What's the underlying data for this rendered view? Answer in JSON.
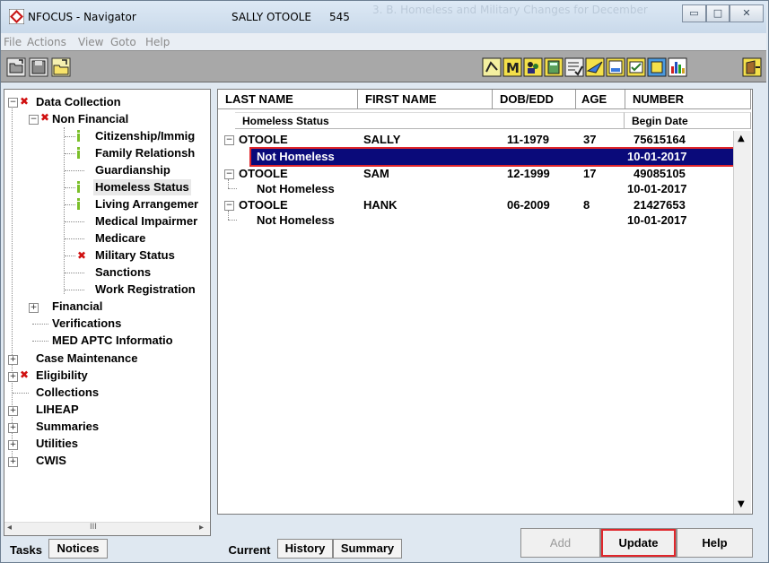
{
  "window": {
    "app_title": "NFOCUS - Navigator",
    "user": "SALLY OTOOLE",
    "user_number": "545",
    "faded_title": "3. B. Homeless and Military Changes for December",
    "minimize": "▭",
    "maximize": "□",
    "close": "✕"
  },
  "menu": [
    "File",
    "Actions",
    "View",
    "Goto",
    "Help"
  ],
  "toolbar_icons": [
    "folder-icon",
    "save-icon",
    "new-folder-icon",
    "gauge-icon",
    "map-icon",
    "people-icon",
    "calculator-icon",
    "checklist-icon",
    "plane-icon",
    "form-icon",
    "check-form-icon",
    "window-icon",
    "bar-chart-icon",
    "exit-icon"
  ],
  "tree": {
    "data_collection": "Data Collection",
    "non_financial": "Non Financial",
    "items": [
      "Citizenship/Immig",
      "Family Relationsh",
      "Guardianship",
      "Homeless Status",
      "Living Arrangemer",
      "Medical Impairmer",
      "Medicare",
      "Military Status",
      "Sanctions",
      "Work Registration"
    ],
    "financial": "Financial",
    "verifications": "Verifications",
    "med_aptc": "MED APTC Informatio",
    "case_maintenance": "Case Maintenance",
    "eligibility": "Eligibility",
    "collections": "Collections",
    "liheap": "LIHEAP",
    "summaries": "Summaries",
    "utilities": "Utilities",
    "cwis": "CWIS"
  },
  "left_tabs": [
    "Tasks",
    "Notices"
  ],
  "grid": {
    "headers": [
      "LAST NAME",
      "FIRST NAME",
      "DOB/EDD",
      "AGE",
      "NUMBER"
    ],
    "subheaders": [
      "Homeless Status",
      "Begin Date"
    ],
    "people": [
      {
        "last": "OTOOLE",
        "first": "SALLY",
        "dob": "11-1979",
        "age": "37",
        "number": "75615164",
        "status": "Not Homeless",
        "begin": "10-01-2017"
      },
      {
        "last": "OTOOLE",
        "first": "SAM",
        "dob": "12-1999",
        "age": "17",
        "number": "49085105",
        "status": "Not Homeless",
        "begin": "10-01-2017"
      },
      {
        "last": "OTOOLE",
        "first": "HANK",
        "dob": "06-2009",
        "age": "8",
        "number": "21427653",
        "status": "Not Homeless",
        "begin": "10-01-2017"
      }
    ]
  },
  "buttons": {
    "add": "Add",
    "update": "Update",
    "help": "Help"
  },
  "bottom_tabs": [
    "Current",
    "History",
    "Summary"
  ],
  "colors": {
    "selection": "#0a0a7a",
    "highlight": "#e0262b",
    "error_mark": "#d01010",
    "ok_mark": "#7bbf2a"
  }
}
